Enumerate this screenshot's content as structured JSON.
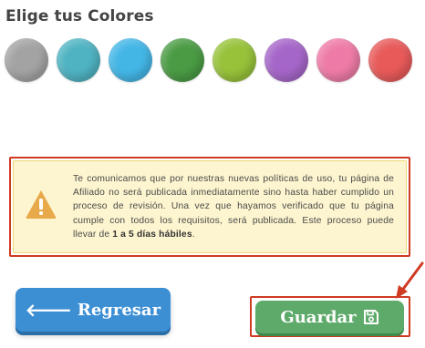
{
  "section": {
    "title": "Elige tus Colores"
  },
  "swatches": [
    {
      "name": "gray",
      "color": "#a3a3a3"
    },
    {
      "name": "teal",
      "color": "#4fb3c2"
    },
    {
      "name": "sky",
      "color": "#43b6e6"
    },
    {
      "name": "green",
      "color": "#4a9b44"
    },
    {
      "name": "lime",
      "color": "#97c23a"
    },
    {
      "name": "purple",
      "color": "#a566c9"
    },
    {
      "name": "pink",
      "color": "#ee7ba7"
    },
    {
      "name": "red",
      "color": "#e85a5a"
    }
  ],
  "warning": {
    "icon": "warning-triangle-icon",
    "text_main": "Te comunicamos que por nuestras nuevas políticas de uso, tu página de Afiliado no será publicada inmediatamente sino hasta haber cumplido un proceso de revisión. Una vez que hayamos verificado que tu página cumple con todos los requisitos, será publicada. Este proceso puede llevar de ",
    "text_bold": "1 a 5 días hábiles",
    "text_end": "."
  },
  "actions": {
    "back_label": "Regresar",
    "back_icon": "arrow-left-icon",
    "save_label": "Guardar",
    "save_icon": "floppy-disk-icon"
  },
  "colors": {
    "back_button": "#3d8fd4",
    "save_button": "#5daa6a",
    "warning_bg": "#fdf5cf",
    "highlight": "#cf3a23"
  }
}
